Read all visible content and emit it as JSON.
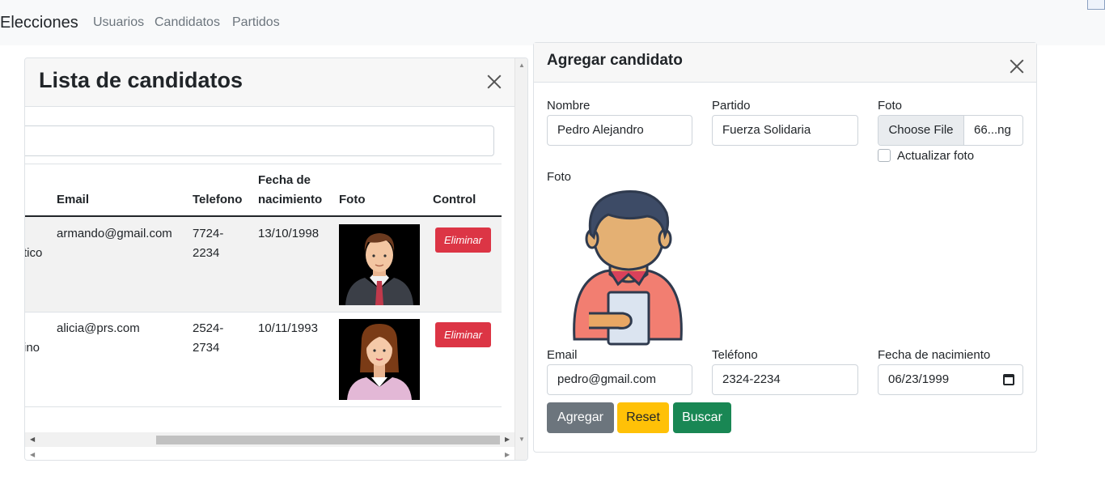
{
  "navbar": {
    "brand": "Elecciones",
    "links": [
      "Usuarios",
      "Candidatos",
      "Partidos"
    ]
  },
  "list_panel": {
    "title": "Lista de candidatos",
    "search_value": "",
    "columns": {
      "email": "Email",
      "telefono": "Telefono",
      "fecha_line1": "Fecha de",
      "fecha_line2": "nacimiento",
      "foto": "Foto",
      "control": "Control"
    },
    "rows": [
      {
        "name_fragment": "tico",
        "email": "armando@gmail.com",
        "telefono_line1": "7724-",
        "telefono_line2": "2234",
        "fecha": "13/10/1998",
        "photo_icon": "male-avatar-icon",
        "delete_label": "Eliminar"
      },
      {
        "name_fragment": "ino",
        "email": "alicia@prs.com",
        "telefono_line1": "2524-",
        "telefono_line2": "2734",
        "fecha": "10/11/1993",
        "photo_icon": "female-avatar-icon",
        "delete_label": "Eliminar"
      }
    ]
  },
  "form_panel": {
    "title": "Agregar candidato",
    "nombre_label": "Nombre",
    "nombre_value": "Pedro Alejandro",
    "partido_label": "Partido",
    "partido_value": "Fuerza Solidaria",
    "foto_label": "Foto",
    "file_button": "Choose File",
    "file_name": "66...ng",
    "actualizar_label": "Actualizar foto",
    "actualizar_checked": false,
    "preview_label": "Foto",
    "preview_icon": "man-holding-clipboard-icon",
    "email_label": "Email",
    "email_value": "pedro@gmail.com",
    "telefono_label": "Teléfono",
    "telefono_value": "2324-2234",
    "fecha_label": "Fecha de nacimiento",
    "fecha_value": "06/23/1999",
    "buttons": {
      "agregar": "Agregar",
      "reset": "Reset",
      "buscar": "Buscar"
    }
  },
  "colors": {
    "danger": "#dc3545",
    "warning": "#ffc107",
    "success": "#198754",
    "secondary": "#6c757d"
  }
}
